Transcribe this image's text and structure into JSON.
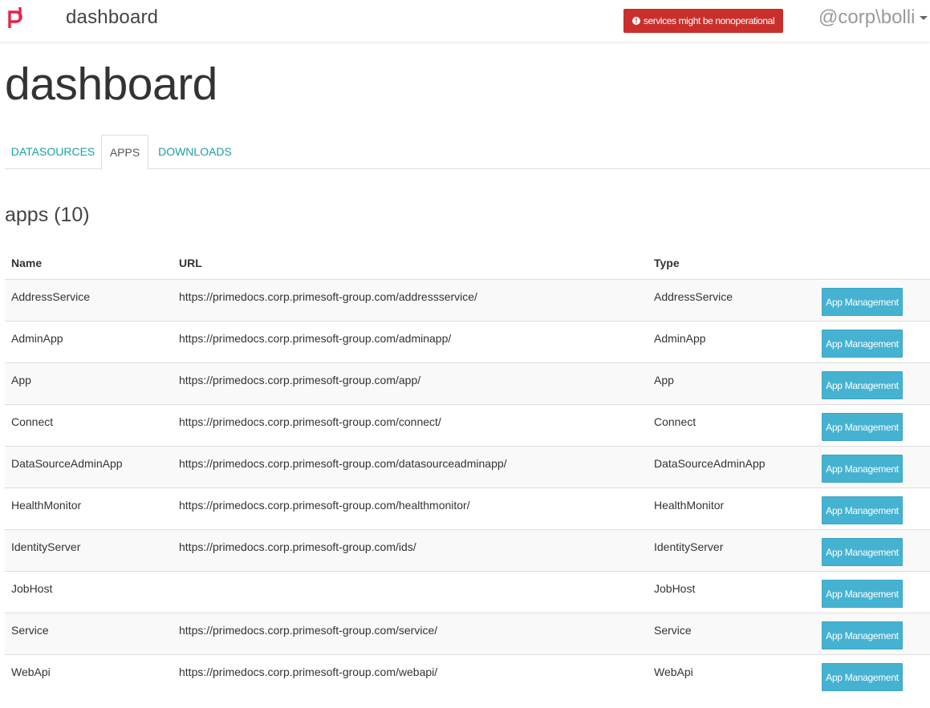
{
  "brand": {
    "logo_icon": "primedocs-logo-icon",
    "brand_color": "#e6234b"
  },
  "navbar": {
    "title": "dashboard",
    "alert": {
      "text": "services might be nonoperational",
      "icon": "exclamation-circle-icon",
      "color": "#c9302c"
    },
    "user": "@corp\\bolli"
  },
  "page": {
    "title": "dashboard"
  },
  "tabs": [
    {
      "label": "DATASOURCES",
      "active": false
    },
    {
      "label": "APPS",
      "active": true
    },
    {
      "label": "DOWNLOADS",
      "active": false
    }
  ],
  "apps": {
    "heading": "apps (10)",
    "columns": {
      "name": "Name",
      "url": "URL",
      "type": "Type"
    },
    "action_label": "App Management",
    "accent_color": "#46b2d1",
    "rows": [
      {
        "name": "AddressService",
        "url": "https://primedocs.corp.primesoft-group.com/addressservice/",
        "type": "AddressService"
      },
      {
        "name": "AdminApp",
        "url": "https://primedocs.corp.primesoft-group.com/adminapp/",
        "type": "AdminApp"
      },
      {
        "name": "App",
        "url": "https://primedocs.corp.primesoft-group.com/app/",
        "type": "App"
      },
      {
        "name": "Connect",
        "url": "https://primedocs.corp.primesoft-group.com/connect/",
        "type": "Connect"
      },
      {
        "name": "DataSourceAdminApp",
        "url": "https://primedocs.corp.primesoft-group.com/datasourceadminapp/",
        "type": "DataSourceAdminApp"
      },
      {
        "name": "HealthMonitor",
        "url": "https://primedocs.corp.primesoft-group.com/healthmonitor/",
        "type": "HealthMonitor"
      },
      {
        "name": "IdentityServer",
        "url": "https://primedocs.corp.primesoft-group.com/ids/",
        "type": "IdentityServer"
      },
      {
        "name": "JobHost",
        "url": "",
        "type": "JobHost"
      },
      {
        "name": "Service",
        "url": "https://primedocs.corp.primesoft-group.com/service/",
        "type": "Service"
      },
      {
        "name": "WebApi",
        "url": "https://primedocs.corp.primesoft-group.com/webapi/",
        "type": "WebApi"
      }
    ]
  }
}
